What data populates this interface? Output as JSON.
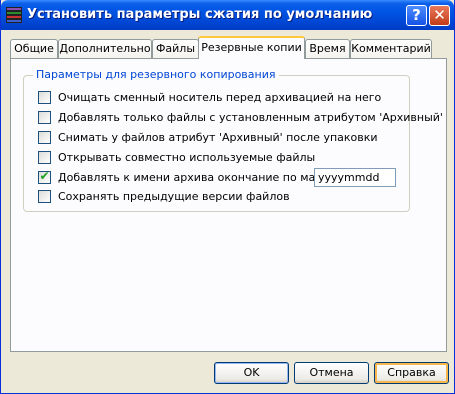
{
  "window": {
    "title": "Установить параметры сжатия по умолчанию",
    "help_glyph": "?",
    "close_glyph": "✕"
  },
  "tabs": [
    {
      "label": "Общие",
      "active": false
    },
    {
      "label": "Дополнительно",
      "active": false
    },
    {
      "label": "Файлы",
      "active": false
    },
    {
      "label": "Резервные копии",
      "active": true
    },
    {
      "label": "Время",
      "active": false
    },
    {
      "label": "Комментарий",
      "active": false
    }
  ],
  "group": {
    "title": "Параметры для резервного копирования",
    "options": [
      {
        "label": "Очищать сменный носитель перед архивацией на него",
        "checked": false
      },
      {
        "label": "Добавлять только файлы с установленным атрибутом 'Архивный'",
        "checked": false
      },
      {
        "label": "Снимать у файлов атрибут 'Архивный' после упаковки",
        "checked": false
      },
      {
        "label": "Открывать совместно используемые файлы",
        "checked": false
      },
      {
        "label": "Добавлять к имени архива окончание по маске:",
        "checked": true
      },
      {
        "label": "Сохранять предыдущие версии файлов",
        "checked": false
      }
    ],
    "mask_value": "yyyymmdd",
    "check_glyph": "✔"
  },
  "buttons": {
    "ok": "OK",
    "cancel": "Отмена",
    "help": "Справка"
  },
  "colors": {
    "titlebar": "#0054e3",
    "dialog_bg": "#ece9d8",
    "group_title": "#0046d5",
    "active_tab_accent": "#ffc83c"
  },
  "icons": {
    "app": "winrar-books-icon"
  }
}
